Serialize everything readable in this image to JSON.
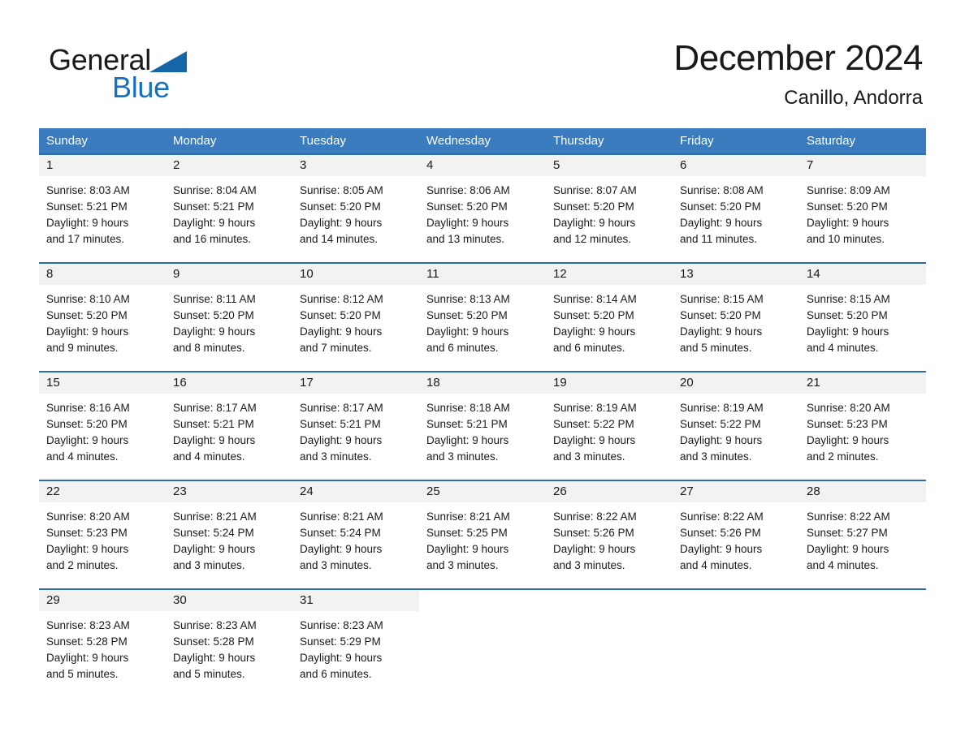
{
  "logo": {
    "text_primary": "General",
    "text_secondary": "Blue",
    "triangle_color": "#1565a8",
    "blue_color": "#1570bd"
  },
  "header": {
    "title": "December 2024",
    "location": "Canillo, Andorra"
  },
  "theme": {
    "header_row_bg": "#3a7cbe",
    "week_divider": "#2c6da8",
    "daynum_band_bg": "#f2f2f2",
    "text_color": "#1a1a1a"
  },
  "weekdays": [
    "Sunday",
    "Monday",
    "Tuesday",
    "Wednesday",
    "Thursday",
    "Friday",
    "Saturday"
  ],
  "weeks": [
    [
      {
        "day": "1",
        "lines": [
          "Sunrise: 8:03 AM",
          "Sunset: 5:21 PM",
          "Daylight: 9 hours",
          "and 17 minutes."
        ]
      },
      {
        "day": "2",
        "lines": [
          "Sunrise: 8:04 AM",
          "Sunset: 5:21 PM",
          "Daylight: 9 hours",
          "and 16 minutes."
        ]
      },
      {
        "day": "3",
        "lines": [
          "Sunrise: 8:05 AM",
          "Sunset: 5:20 PM",
          "Daylight: 9 hours",
          "and 14 minutes."
        ]
      },
      {
        "day": "4",
        "lines": [
          "Sunrise: 8:06 AM",
          "Sunset: 5:20 PM",
          "Daylight: 9 hours",
          "and 13 minutes."
        ]
      },
      {
        "day": "5",
        "lines": [
          "Sunrise: 8:07 AM",
          "Sunset: 5:20 PM",
          "Daylight: 9 hours",
          "and 12 minutes."
        ]
      },
      {
        "day": "6",
        "lines": [
          "Sunrise: 8:08 AM",
          "Sunset: 5:20 PM",
          "Daylight: 9 hours",
          "and 11 minutes."
        ]
      },
      {
        "day": "7",
        "lines": [
          "Sunrise: 8:09 AM",
          "Sunset: 5:20 PM",
          "Daylight: 9 hours",
          "and 10 minutes."
        ]
      }
    ],
    [
      {
        "day": "8",
        "lines": [
          "Sunrise: 8:10 AM",
          "Sunset: 5:20 PM",
          "Daylight: 9 hours",
          "and 9 minutes."
        ]
      },
      {
        "day": "9",
        "lines": [
          "Sunrise: 8:11 AM",
          "Sunset: 5:20 PM",
          "Daylight: 9 hours",
          "and 8 minutes."
        ]
      },
      {
        "day": "10",
        "lines": [
          "Sunrise: 8:12 AM",
          "Sunset: 5:20 PM",
          "Daylight: 9 hours",
          "and 7 minutes."
        ]
      },
      {
        "day": "11",
        "lines": [
          "Sunrise: 8:13 AM",
          "Sunset: 5:20 PM",
          "Daylight: 9 hours",
          "and 6 minutes."
        ]
      },
      {
        "day": "12",
        "lines": [
          "Sunrise: 8:14 AM",
          "Sunset: 5:20 PM",
          "Daylight: 9 hours",
          "and 6 minutes."
        ]
      },
      {
        "day": "13",
        "lines": [
          "Sunrise: 8:15 AM",
          "Sunset: 5:20 PM",
          "Daylight: 9 hours",
          "and 5 minutes."
        ]
      },
      {
        "day": "14",
        "lines": [
          "Sunrise: 8:15 AM",
          "Sunset: 5:20 PM",
          "Daylight: 9 hours",
          "and 4 minutes."
        ]
      }
    ],
    [
      {
        "day": "15",
        "lines": [
          "Sunrise: 8:16 AM",
          "Sunset: 5:20 PM",
          "Daylight: 9 hours",
          "and 4 minutes."
        ]
      },
      {
        "day": "16",
        "lines": [
          "Sunrise: 8:17 AM",
          "Sunset: 5:21 PM",
          "Daylight: 9 hours",
          "and 4 minutes."
        ]
      },
      {
        "day": "17",
        "lines": [
          "Sunrise: 8:17 AM",
          "Sunset: 5:21 PM",
          "Daylight: 9 hours",
          "and 3 minutes."
        ]
      },
      {
        "day": "18",
        "lines": [
          "Sunrise: 8:18 AM",
          "Sunset: 5:21 PM",
          "Daylight: 9 hours",
          "and 3 minutes."
        ]
      },
      {
        "day": "19",
        "lines": [
          "Sunrise: 8:19 AM",
          "Sunset: 5:22 PM",
          "Daylight: 9 hours",
          "and 3 minutes."
        ]
      },
      {
        "day": "20",
        "lines": [
          "Sunrise: 8:19 AM",
          "Sunset: 5:22 PM",
          "Daylight: 9 hours",
          "and 3 minutes."
        ]
      },
      {
        "day": "21",
        "lines": [
          "Sunrise: 8:20 AM",
          "Sunset: 5:23 PM",
          "Daylight: 9 hours",
          "and 2 minutes."
        ]
      }
    ],
    [
      {
        "day": "22",
        "lines": [
          "Sunrise: 8:20 AM",
          "Sunset: 5:23 PM",
          "Daylight: 9 hours",
          "and 2 minutes."
        ]
      },
      {
        "day": "23",
        "lines": [
          "Sunrise: 8:21 AM",
          "Sunset: 5:24 PM",
          "Daylight: 9 hours",
          "and 3 minutes."
        ]
      },
      {
        "day": "24",
        "lines": [
          "Sunrise: 8:21 AM",
          "Sunset: 5:24 PM",
          "Daylight: 9 hours",
          "and 3 minutes."
        ]
      },
      {
        "day": "25",
        "lines": [
          "Sunrise: 8:21 AM",
          "Sunset: 5:25 PM",
          "Daylight: 9 hours",
          "and 3 minutes."
        ]
      },
      {
        "day": "26",
        "lines": [
          "Sunrise: 8:22 AM",
          "Sunset: 5:26 PM",
          "Daylight: 9 hours",
          "and 3 minutes."
        ]
      },
      {
        "day": "27",
        "lines": [
          "Sunrise: 8:22 AM",
          "Sunset: 5:26 PM",
          "Daylight: 9 hours",
          "and 4 minutes."
        ]
      },
      {
        "day": "28",
        "lines": [
          "Sunrise: 8:22 AM",
          "Sunset: 5:27 PM",
          "Daylight: 9 hours",
          "and 4 minutes."
        ]
      }
    ],
    [
      {
        "day": "29",
        "lines": [
          "Sunrise: 8:23 AM",
          "Sunset: 5:28 PM",
          "Daylight: 9 hours",
          "and 5 minutes."
        ]
      },
      {
        "day": "30",
        "lines": [
          "Sunrise: 8:23 AM",
          "Sunset: 5:28 PM",
          "Daylight: 9 hours",
          "and 5 minutes."
        ]
      },
      {
        "day": "31",
        "lines": [
          "Sunrise: 8:23 AM",
          "Sunset: 5:29 PM",
          "Daylight: 9 hours",
          "and 6 minutes."
        ]
      },
      {
        "day": "",
        "lines": []
      },
      {
        "day": "",
        "lines": []
      },
      {
        "day": "",
        "lines": []
      },
      {
        "day": "",
        "lines": []
      }
    ]
  ]
}
